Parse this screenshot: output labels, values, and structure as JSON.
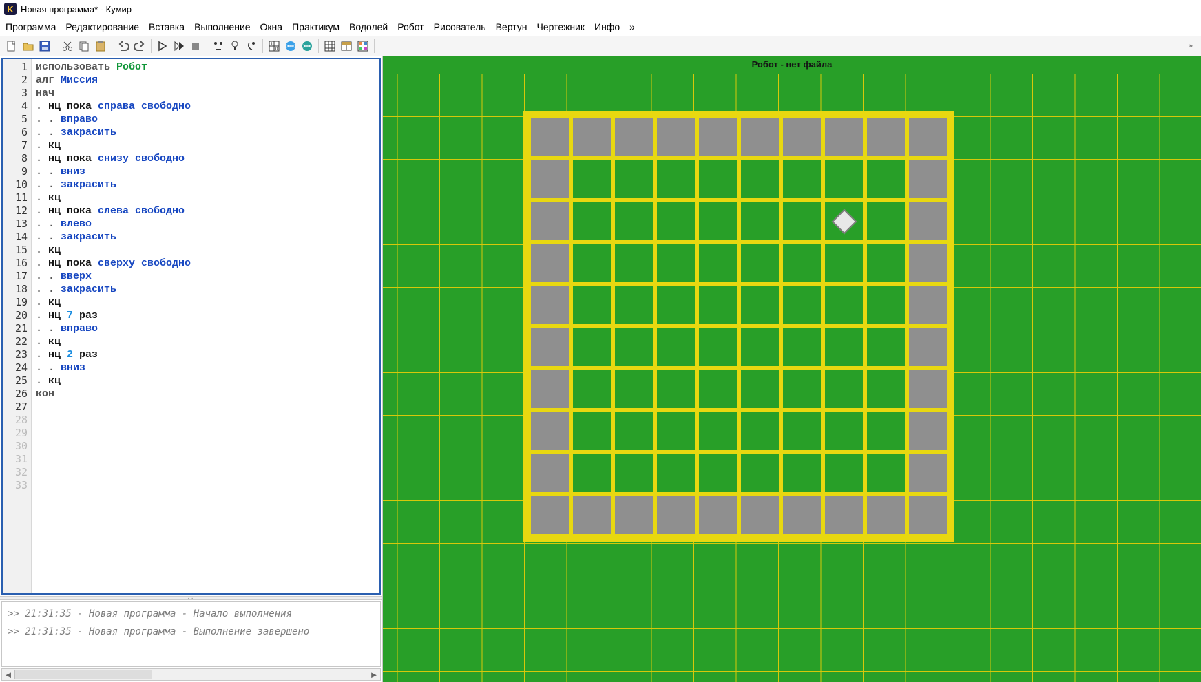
{
  "window": {
    "title": "Новая программа* - Кумир",
    "app_letter": "K"
  },
  "menu": [
    "Программа",
    "Редактирование",
    "Вставка",
    "Выполнение",
    "Окна",
    "Практикум",
    "Водолей",
    "Робот",
    "Рисователь",
    "Вертун",
    "Чертежник",
    "Инфо",
    "»"
  ],
  "toolbar_icons": [
    "new-file",
    "open-file",
    "save-file",
    "|",
    "cut",
    "copy",
    "paste",
    "|",
    "undo",
    "redo",
    "|",
    "run",
    "run-step",
    "stop",
    "|",
    "play-begin",
    "play-pause",
    "play-end",
    "|",
    "grid-tool",
    "globe-blue",
    "globe-teal",
    "|",
    "grid-black",
    "table",
    "paint",
    "|",
    "chev"
  ],
  "code": {
    "total_lines": 33,
    "filled_lines": 27,
    "tokens": [
      [
        [
          "kw",
          "использовать "
        ],
        [
          "cls",
          "Робот"
        ]
      ],
      [
        [
          "kw",
          "алг "
        ],
        [
          "id",
          "Миссия"
        ]
      ],
      [
        [
          "kw",
          "нач"
        ]
      ],
      [
        [
          "dot",
          ". "
        ],
        [
          "dark",
          "нц пока "
        ],
        [
          "id",
          "справа свободно"
        ]
      ],
      [
        [
          "dot",
          ". . "
        ],
        [
          "id",
          "вправо"
        ]
      ],
      [
        [
          "dot",
          ". . "
        ],
        [
          "id",
          "закрасить"
        ]
      ],
      [
        [
          "dot",
          ". "
        ],
        [
          "dark",
          "кц"
        ]
      ],
      [
        [
          "dot",
          ". "
        ],
        [
          "dark",
          "нц пока "
        ],
        [
          "id",
          "снизу свободно"
        ]
      ],
      [
        [
          "dot",
          ". . "
        ],
        [
          "id",
          "вниз"
        ]
      ],
      [
        [
          "dot",
          ". . "
        ],
        [
          "id",
          "закрасить"
        ]
      ],
      [
        [
          "dot",
          ". "
        ],
        [
          "dark",
          "кц"
        ]
      ],
      [
        [
          "dot",
          ". "
        ],
        [
          "dark",
          "нц пока "
        ],
        [
          "id",
          "слева свободно"
        ]
      ],
      [
        [
          "dot",
          ". . "
        ],
        [
          "id",
          "влево"
        ]
      ],
      [
        [
          "dot",
          ". . "
        ],
        [
          "id",
          "закрасить"
        ]
      ],
      [
        [
          "dot",
          ". "
        ],
        [
          "dark",
          "кц"
        ]
      ],
      [
        [
          "dot",
          ". "
        ],
        [
          "dark",
          "нц пока "
        ],
        [
          "id",
          "сверху свободно"
        ]
      ],
      [
        [
          "dot",
          ". . "
        ],
        [
          "id",
          "вверх"
        ]
      ],
      [
        [
          "dot",
          ". . "
        ],
        [
          "id",
          "закрасить"
        ]
      ],
      [
        [
          "dot",
          ". "
        ],
        [
          "dark",
          "кц"
        ]
      ],
      [
        [
          "dot",
          ". "
        ],
        [
          "dark",
          "нц "
        ],
        [
          "num",
          "7"
        ],
        [
          "dark",
          " раз"
        ]
      ],
      [
        [
          "dot",
          ". . "
        ],
        [
          "id",
          "вправо"
        ]
      ],
      [
        [
          "dot",
          ". "
        ],
        [
          "dark",
          "кц"
        ]
      ],
      [
        [
          "dot",
          ". "
        ],
        [
          "dark",
          "нц "
        ],
        [
          "num",
          "2"
        ],
        [
          "dark",
          " раз"
        ]
      ],
      [
        [
          "dot",
          ". . "
        ],
        [
          "id",
          "вниз"
        ]
      ],
      [
        [
          "dot",
          ". "
        ],
        [
          "dark",
          "кц"
        ]
      ],
      [
        [
          "kw",
          "кон"
        ]
      ],
      []
    ]
  },
  "console": [
    ">> 21:31:35 - Новая программа - Начало выполнения",
    ">> 21:31:35 - Новая программа - Выполнение завершено"
  ],
  "field": {
    "title": "Робот - нет файла",
    "cols": 10,
    "rows": 10,
    "painted": [
      [
        0,
        0
      ],
      [
        0,
        1
      ],
      [
        0,
        2
      ],
      [
        0,
        3
      ],
      [
        0,
        4
      ],
      [
        0,
        5
      ],
      [
        0,
        6
      ],
      [
        0,
        7
      ],
      [
        0,
        8
      ],
      [
        0,
        9
      ],
      [
        1,
        0
      ],
      [
        1,
        9
      ],
      [
        2,
        0
      ],
      [
        2,
        9
      ],
      [
        3,
        0
      ],
      [
        3,
        9
      ],
      [
        4,
        0
      ],
      [
        4,
        9
      ],
      [
        5,
        0
      ],
      [
        5,
        9
      ],
      [
        6,
        0
      ],
      [
        6,
        9
      ],
      [
        7,
        0
      ],
      [
        7,
        9
      ],
      [
        8,
        0
      ],
      [
        8,
        9
      ],
      [
        9,
        0
      ],
      [
        9,
        1
      ],
      [
        9,
        2
      ],
      [
        9,
        3
      ],
      [
        9,
        4
      ],
      [
        9,
        5
      ],
      [
        9,
        6
      ],
      [
        9,
        7
      ],
      [
        9,
        8
      ],
      [
        9,
        9
      ]
    ],
    "robot": {
      "row": 2,
      "col": 7
    }
  }
}
